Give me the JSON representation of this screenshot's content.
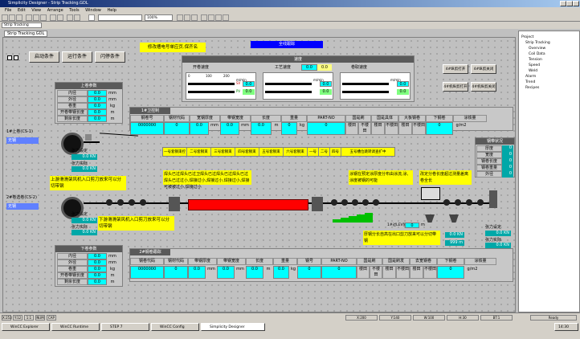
{
  "window": {
    "title": "Simplicity Designer - Strip Tracking.GDL"
  },
  "menu": [
    "File",
    "Edit",
    "View",
    "Arrange",
    "Tools",
    "Window",
    "Help"
  ],
  "toolbar": {
    "combo": "Strip Tracking",
    "zoom": "100%"
  },
  "tab": {
    "label": "Strip Tracking.GDL"
  },
  "header": {
    "notice": "修改槽电号单应页.保齐名",
    "title": "全线跟踪"
  },
  "control_buttons": [
    "启动条件",
    "运行条件",
    "闪停条件"
  ],
  "speed_panel": {
    "title": "速度",
    "value1": "0.0",
    "value2": "0.0",
    "sections": [
      "开卷速度",
      "工艺速度",
      "卷取速度"
    ],
    "unit": "m/min",
    "scale": [
      "0",
      "100",
      "200",
      "300"
    ],
    "sv": "SV",
    "pv": "PV",
    "values": [
      "0.0",
      "0.0",
      "0.0"
    ]
  },
  "right_btns": [
    "4#纵剪打开",
    "4#纵剪关闭",
    "4#机纵剪打开",
    "4#机纵剪关闭"
  ],
  "upper_coil": {
    "title": "上卷参数",
    "rows": [
      {
        "label": "内径",
        "value": "0.0",
        "unit": "mm"
      },
      {
        "label": "外径",
        "value": "0.0",
        "unit": "mm"
      },
      {
        "label": "卷重",
        "value": "0.0",
        "unit": "kg"
      },
      {
        "label": "开卷带钢长度",
        "value": "0.0",
        "unit": "m"
      },
      {
        "label": "剩余长度",
        "value": "0.0",
        "unit": "m"
      }
    ]
  },
  "lower_coil": {
    "title": "下卷参数",
    "rows": [
      {
        "label": "内径",
        "value": "0.0",
        "unit": "mm"
      },
      {
        "label": "外径",
        "value": "0.0",
        "unit": "mm"
      },
      {
        "label": "卷重",
        "value": "0.0",
        "unit": "kg"
      },
      {
        "label": "开卷带钢长度",
        "value": "0.0",
        "unit": "m"
      },
      {
        "label": "剩余长度",
        "value": "0.0",
        "unit": "m"
      }
    ]
  },
  "upper_table": {
    "title": "1#卫控制",
    "headers": [
      "钢卷号",
      "钢材代码",
      "宽钢厚度",
      "带钢宽度",
      "长度",
      "重量",
      "PART-NO",
      "国是刷",
      "国是具体",
      "大板钢卷",
      "下钢卷",
      "涂铁量"
    ],
    "row": [
      "0000000",
      "0",
      "0.0",
      "0.0",
      "mm",
      "0.0",
      "mm",
      "0.0",
      "m",
      "0",
      "kg",
      "0",
      "0",
      "楼田",
      "不楼田",
      "楼田",
      "不楼田",
      "0",
      "g/m2"
    ]
  },
  "lower_table": {
    "title": "2#钢卷跟踪",
    "headers": [
      "钢卷代码",
      "钢材代码",
      "带钢厚度",
      "带钢宽度",
      "长度",
      "重量",
      "钢号",
      "PART-NO",
      "国是刷",
      "国是刷发",
      "去宽钢卷",
      "下钢卷",
      "涂铁量"
    ],
    "row": [
      "0000000",
      "0",
      "0.0",
      "0.0",
      "mm",
      "0.0",
      "mm",
      "0.0",
      "m",
      "0.0",
      "kg",
      "0",
      "0",
      "楼田",
      "不楼田",
      "楼田",
      "不楼田",
      "0",
      "g/m2"
    ]
  },
  "status_cards": [
    {
      "label": "1#上卷(CS-1)",
      "value": "0%",
      "status": "无钢"
    },
    {
      "label": "2#卷选卷(CS-2)",
      "value": "0%",
      "status": "无钢"
    }
  ],
  "tension_top": {
    "label1": "张力设定",
    "value1": "0.0 KN",
    "label2": "张力实际",
    "value2": "0.0 KN"
  },
  "tension_bottom": {
    "label1": "张力设定",
    "value1": "0.0 KN",
    "label2": "张力实际",
    "value2": "0.0 KN"
  },
  "tension_right": {
    "label1": "张力设定",
    "value1": "0.0 KN",
    "label2": "张力实际",
    "value2": "0.0 KN"
  },
  "weld_labels": [
    "一号套钢束控",
    "二号套钢束",
    "三号套钢束",
    "四号套钢束",
    "五号套钢束",
    "六号套钢束",
    "一号",
    "二号",
    "四号",
    "五号槽位跳转调查扩中"
  ],
  "messages": {
    "m1": "上游滑滑架风机入口剪刀放来可以分切带钢",
    "m2": "下游滑滑架风机入口剪刀放来可以分切带钢",
    "m3": "焊头已过焊头已过卫焊头已过焊头已过焊头已过焊头已过过小,焊接过小,焊接过小,焊接过小,焊接可被被过小,焊接过小",
    "m4": "涂钢在预定涂厚度分布由涂流,涂,涂度被钢的可能",
    "m5": "改定分卷长度超过测量差离卷全长",
    "m6": "厚钢分长自高在出口剪刀放来可以分切带钢"
  },
  "right_mini_panel": {
    "title": "钢带状况",
    "rows": [
      {
        "label": "厚度",
        "value": "0"
      },
      {
        "label": "宽度",
        "value": "0"
      },
      {
        "label": "钢卷长度",
        "value": "0"
      },
      {
        "label": "钢卷重量",
        "value": "0"
      },
      {
        "label": "外径",
        "value": "0"
      }
    ]
  },
  "misc": {
    "val_tension_set": "0.0",
    "unit_kn": "KN",
    "unit_mm": "mm",
    "label_len": "1#过LEV值",
    "len_val": "0",
    "len_unit": "m",
    "right_small": "0.0 KN",
    "right_small2": "999 m",
    "right_kn": "0.0 KN"
  },
  "right_tree": [
    "Project",
    "Strip Tracking",
    "Overview",
    "Coil Data",
    "Tension",
    "Speed",
    "Weld",
    "Alarm",
    "Trend",
    "Recipes"
  ],
  "statusbar": {
    "cells": [
      "X:253",
      "Y:12",
      "1:1",
      "NUM",
      "CAP",
      "X:200",
      "Y:140",
      "W:100",
      "H:30",
      "BT:1"
    ],
    "right": "Ready"
  },
  "taskbar": [
    {
      "label": "WinCC Explorer",
      "active": false
    },
    {
      "label": "WinCC Runtime",
      "active": false
    },
    {
      "label": "STEP 7",
      "active": false
    },
    {
      "label": "WinCC Config",
      "active": false
    },
    {
      "label": "Simplicity Designer",
      "active": true
    },
    {
      "label": "14:30",
      "active": false
    }
  ],
  "colors": {
    "cyan": "#00ffff",
    "teal": "#00a8a8",
    "blue": "#0000ff",
    "yellow": "#ffff00",
    "red": "#ff0000"
  }
}
